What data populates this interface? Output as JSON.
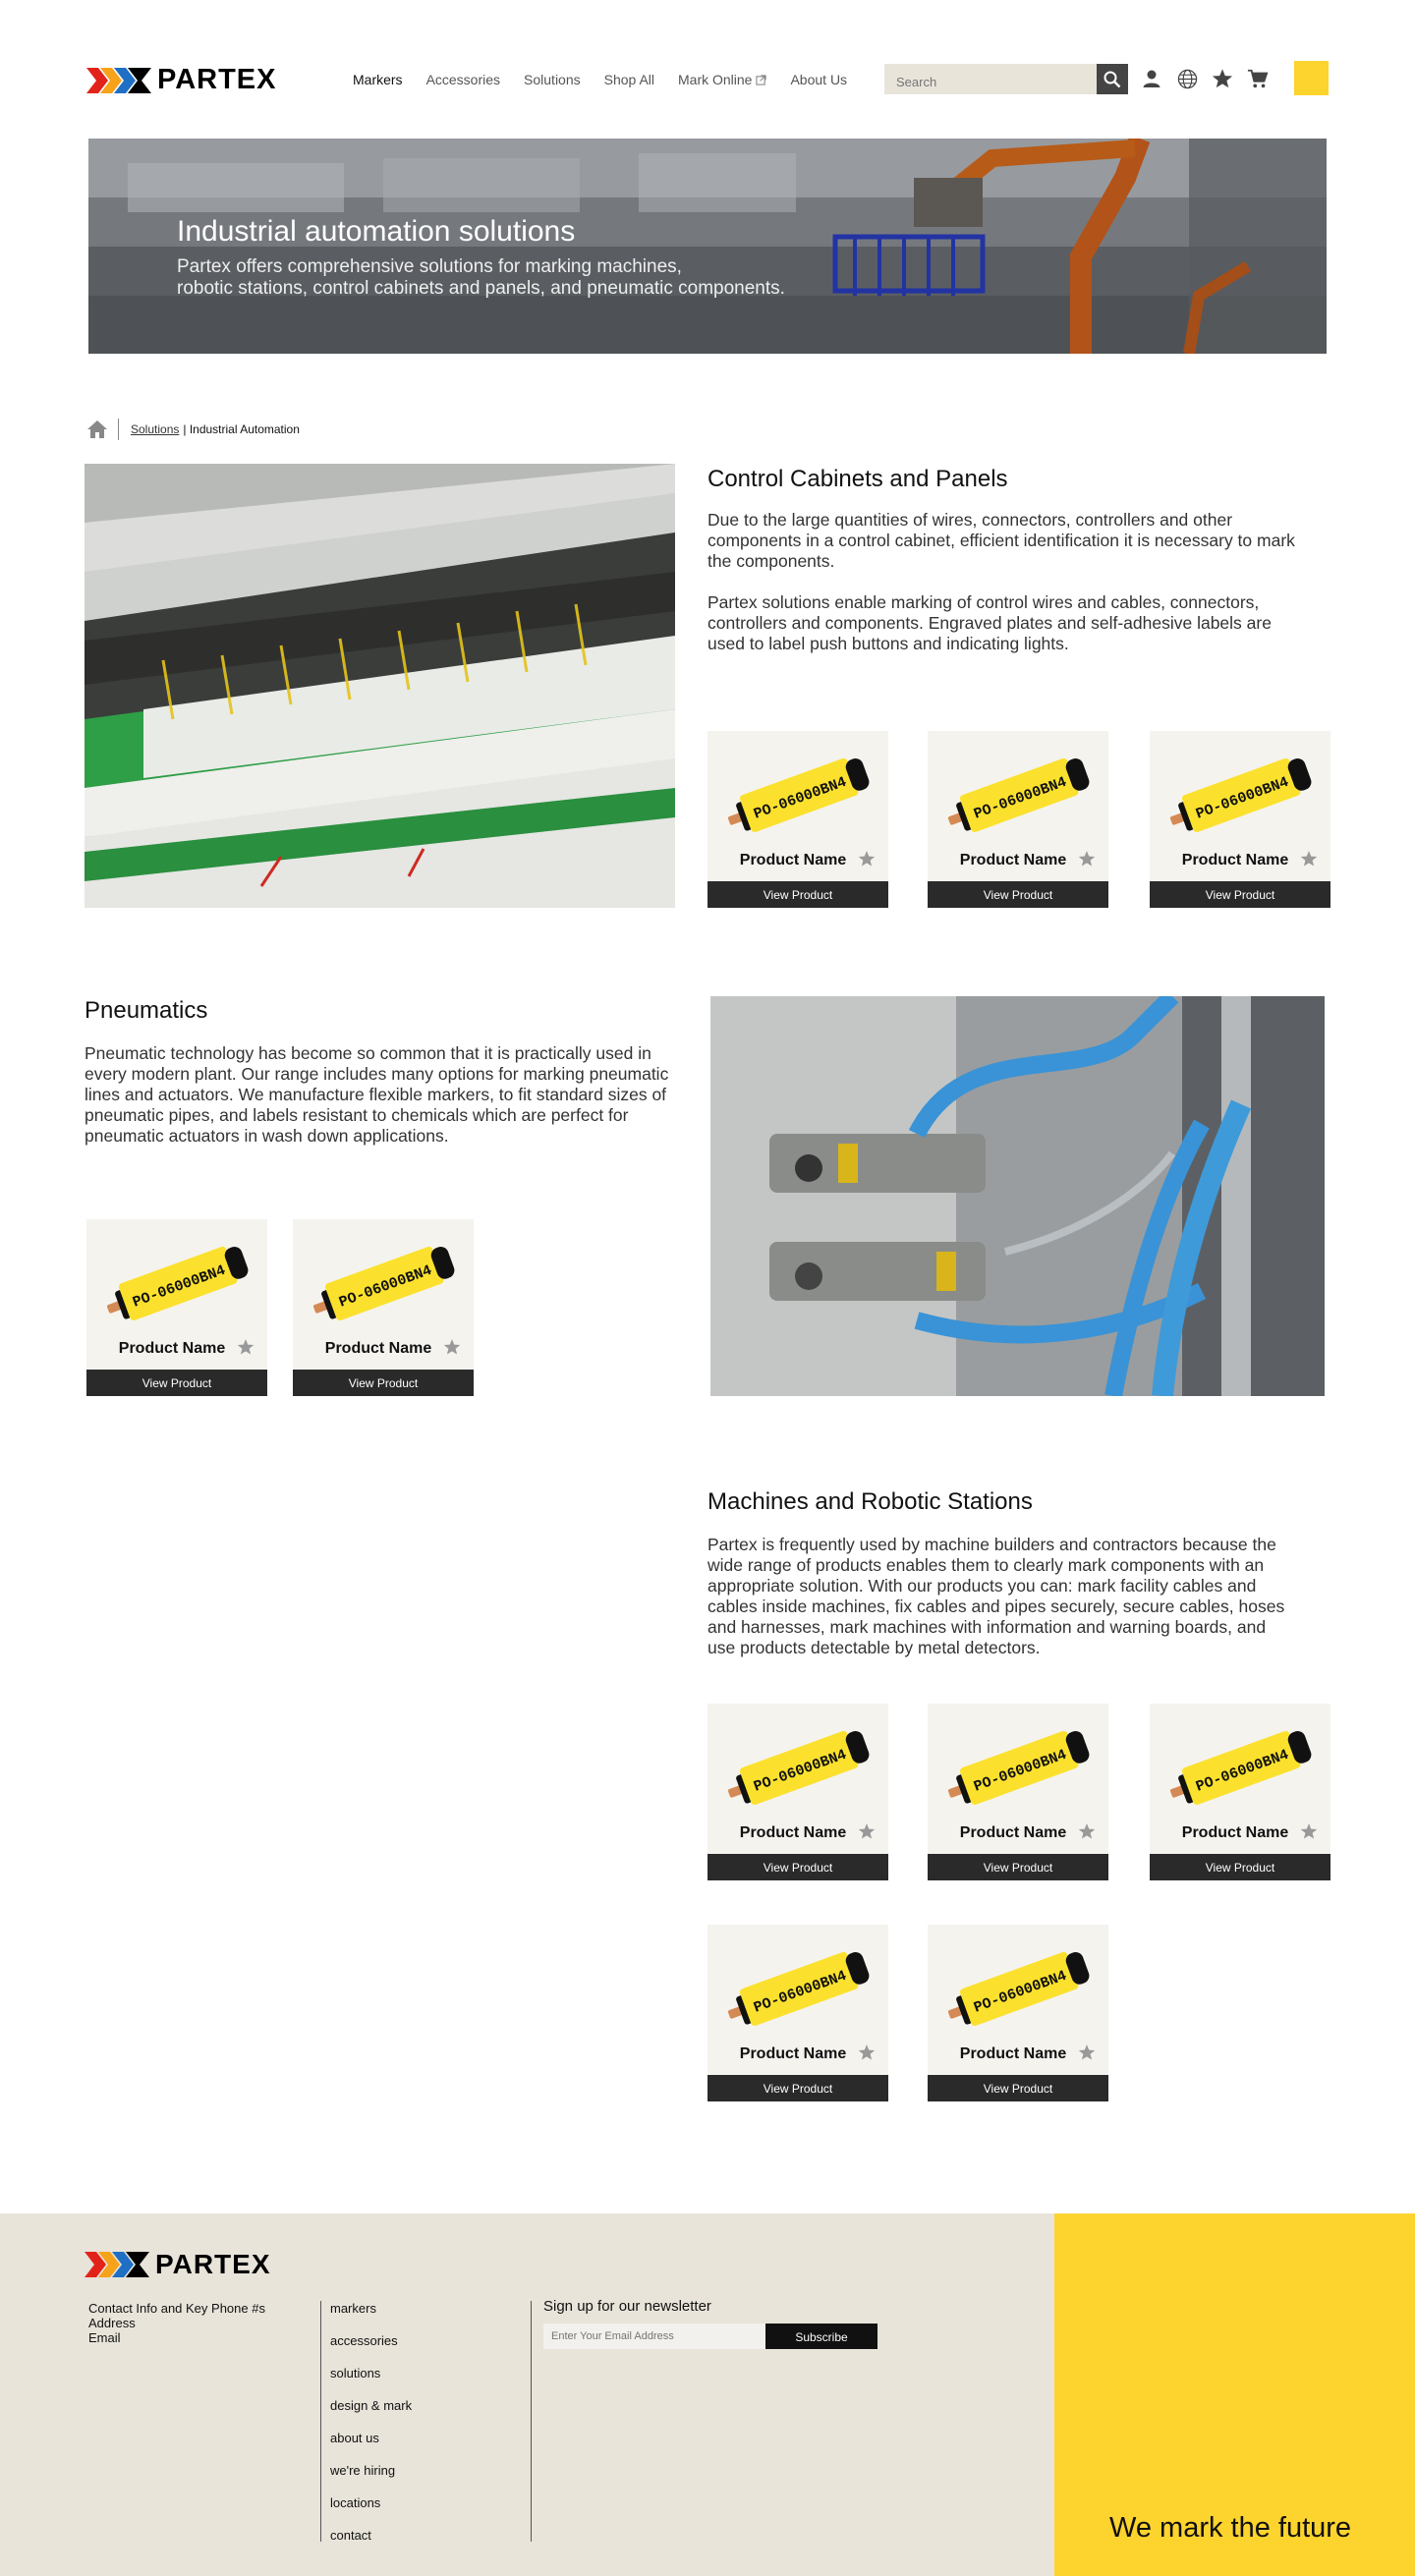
{
  "header": {
    "logo_text": "PARTEX",
    "nav": [
      "Markers",
      "Accessories",
      "Solutions",
      "Shop All",
      "Mark Online",
      "About Us"
    ],
    "search_placeholder": "Search"
  },
  "hero": {
    "title": "Industrial automation solutions",
    "subtitle_line1": "Partex offers comprehensive solutions for marking machines,",
    "subtitle_line2": "robotic stations, control cabinets and panels, and pneumatic components."
  },
  "breadcrumb": {
    "link": "Solutions",
    "current": "| Industrial Automation"
  },
  "sections": {
    "cabinets": {
      "title": "Control Cabinets and Panels",
      "p1": "Due to the large quantities of wires, connectors, controllers and other components in a control cabinet, efficient identification it is necessary to mark the components.",
      "p2": "Partex solutions enable marking of control wires and cables, connectors, controllers and components. Engraved plates and self-adhesive labels are used to label push buttons and indicating lights."
    },
    "pneumatics": {
      "title": "Pneumatics",
      "p1": "Pneumatic technology has become so common that it is practically used in every modern plant. Our range includes many options for marking pneumatic lines and actuators. We manufacture flexible markers, to fit standard sizes of pneumatic pipes, and labels resistant to chemicals which are perfect for pneumatic actuators in wash down applications."
    },
    "machines": {
      "title": "Machines and Robotic Stations",
      "p1": "Partex is frequently used by machine builders and contractors because the wide range of products enables them to clearly mark components with an appropriate solution. With our products you can: mark facility cables and cables inside machines, fix cables and pipes securely, secure cables, hoses and harnesses, mark machines with information and warning boards, and use products detectable by metal detectors."
    }
  },
  "product": {
    "name": "Product Name",
    "button": "View Product",
    "marker_text": "PO-06000BN4"
  },
  "footer": {
    "logo_text": "PARTEX",
    "contact_line1": "Contact Info and Key Phone #s",
    "contact_line2": "Address",
    "contact_line3": "Email",
    "links": [
      "markers",
      "accessories",
      "solutions",
      "design & mark",
      "about us",
      "we're hiring",
      "locations",
      "contact"
    ],
    "newsletter_title": "Sign up for our newsletter",
    "email_placeholder": "Enter Your Email Address",
    "subscribe": "Subscribe",
    "tagline": "We mark the future"
  },
  "colors": {
    "accent_yellow": "#fdd32d",
    "footer_bg": "#e8e4da",
    "button_dark": "#2a2a2a"
  }
}
